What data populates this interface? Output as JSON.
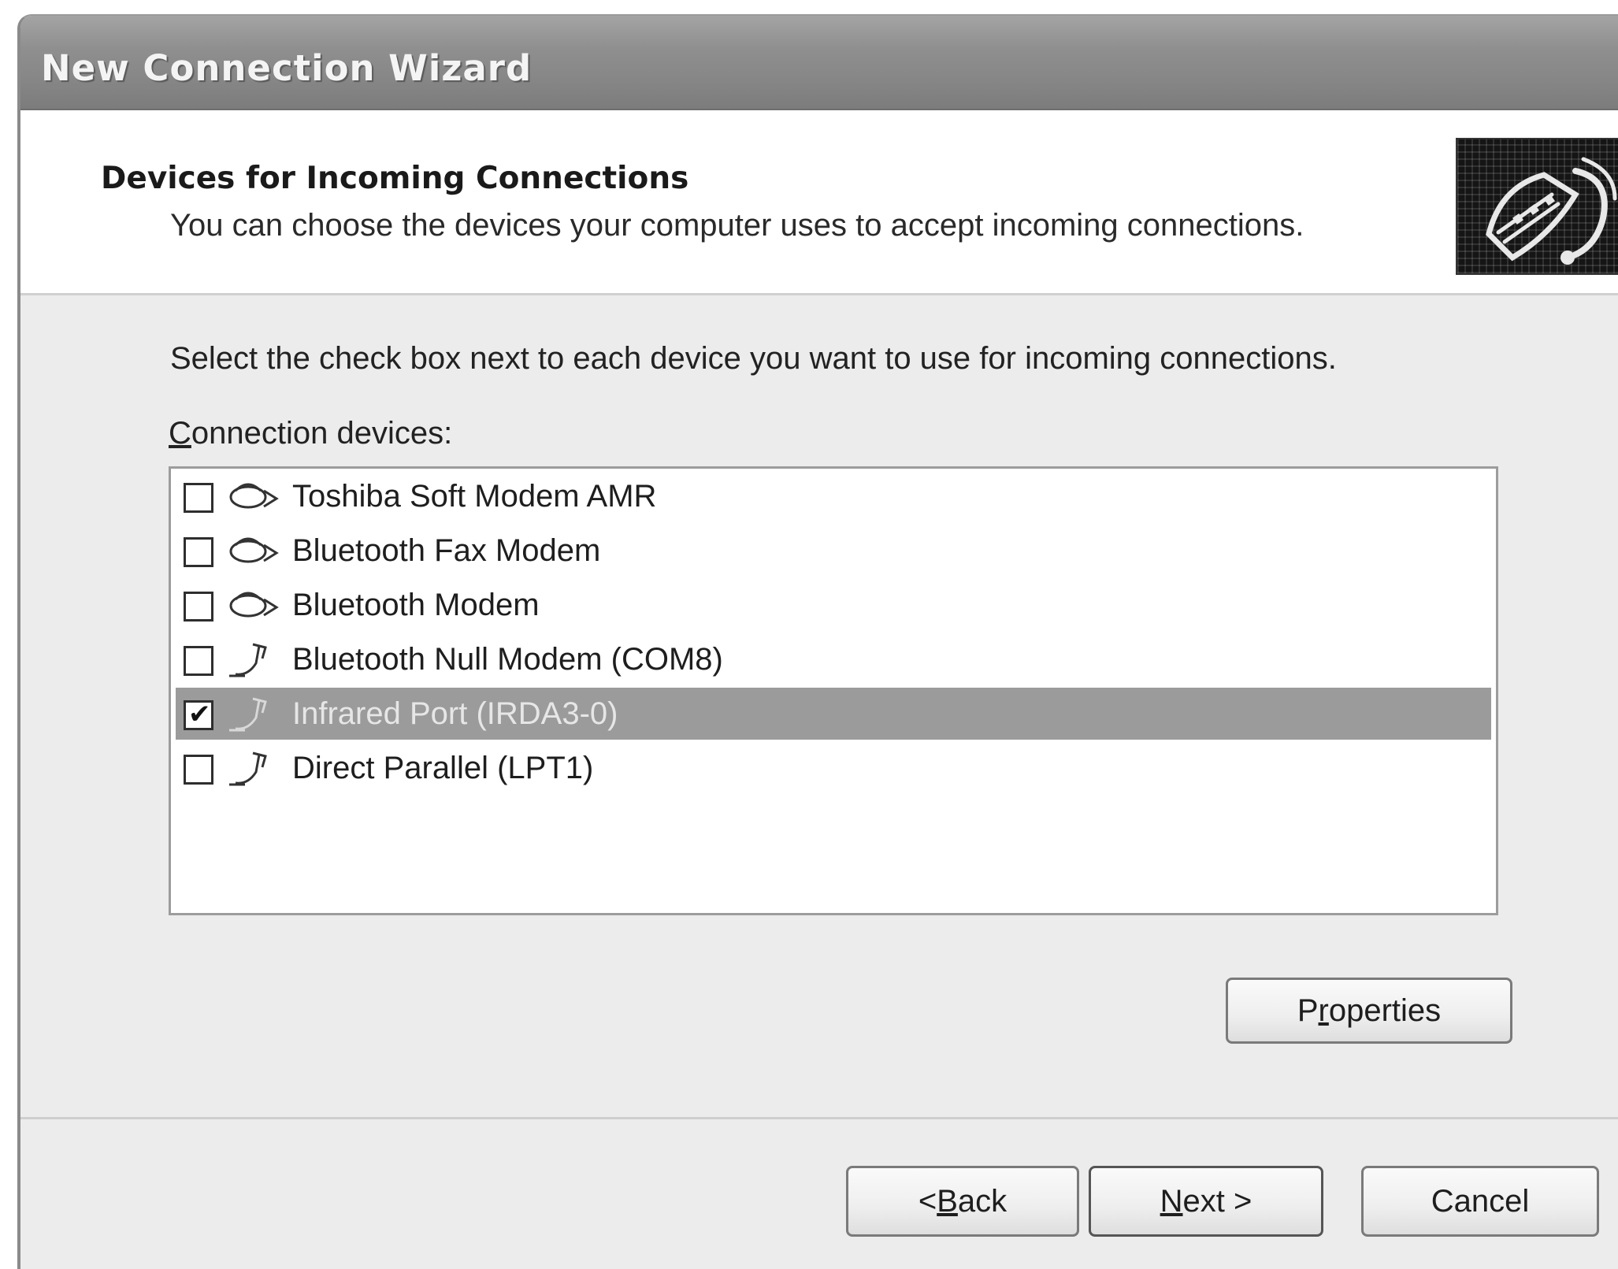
{
  "window": {
    "title": "New Connection Wizard"
  },
  "header": {
    "title": "Devices for Incoming Connections",
    "subtitle": "You can choose the devices your computer uses to accept incoming connections.",
    "icon": "connection-cable-icon"
  },
  "instruction": "Select the check box next to each device you want to use for incoming connections.",
  "devices_label": {
    "mnemonic": "C",
    "rest": "onnection devices:"
  },
  "devices": [
    {
      "label": "Toshiba Soft Modem AMR",
      "checked": false,
      "selected": false,
      "icon": "modem-icon"
    },
    {
      "label": "Bluetooth Fax Modem",
      "checked": false,
      "selected": false,
      "icon": "modem-icon"
    },
    {
      "label": "Bluetooth Modem",
      "checked": false,
      "selected": false,
      "icon": "modem-icon"
    },
    {
      "label": "Bluetooth Null Modem (COM8)",
      "checked": false,
      "selected": false,
      "icon": "cable-icon"
    },
    {
      "label": "Infrared Port (IRDA3-0)",
      "checked": true,
      "selected": true,
      "icon": "cable-icon"
    },
    {
      "label": "Direct Parallel (LPT1)",
      "checked": false,
      "selected": false,
      "icon": "cable-icon"
    }
  ],
  "buttons": {
    "properties": {
      "pre": "P",
      "mn": "r",
      "post": "operties"
    },
    "back": {
      "pre": "< ",
      "mn": "B",
      "post": "ack"
    },
    "next": {
      "pre": "",
      "mn": "N",
      "post": "ext >"
    },
    "cancel": "Cancel"
  },
  "colors": {
    "title_bar": "#8f8f8f",
    "selection": "#9b9b9b",
    "dialog_background": "#ececec"
  }
}
